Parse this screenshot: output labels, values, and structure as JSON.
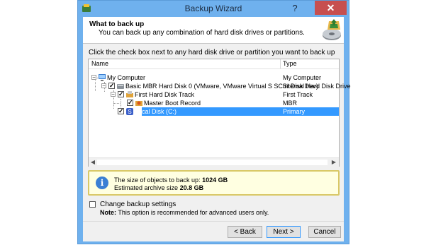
{
  "window": {
    "title": "Backup Wizard",
    "help_glyph": "?",
    "close_glyph": "✕"
  },
  "header": {
    "title": "What to back up",
    "subtitle": "You can back up any combination of hard disk drives or partitions."
  },
  "instruction": "Click the check box next to any hard disk drive or partition you want to back up",
  "tree": {
    "columns": {
      "name": "Name",
      "type": "Type"
    },
    "rows": [
      {
        "name": "My Computer",
        "type": "My Computer",
        "icon": "computer-icon",
        "checked": false
      },
      {
        "name": "Basic MBR Hard Disk 0 (VMware, VMware Virtual S SCSI Disk Dev)",
        "type": "Internal Hard Disk Drive",
        "icon": "hard-disk-icon",
        "checked": true
      },
      {
        "name": "First Hard Disk Track",
        "type": "First Track",
        "icon": "disk-track-icon",
        "checked": true
      },
      {
        "name": "Master Boot Record",
        "type": "MBR",
        "icon": "boot-record-icon",
        "checked": true
      },
      {
        "name": "Local Disk (C:)",
        "type": "Primary",
        "icon": "partition-icon",
        "checked": true,
        "selected": true
      }
    ]
  },
  "info": {
    "size_label": "The size of objects to back up:",
    "size_value": "1024 GB",
    "archive_label": "Estimated archive size",
    "archive_value": "20.8 GB"
  },
  "options": {
    "change_settings_label": "Change backup settings",
    "change_settings_checked": false,
    "note_label": "Note:",
    "note_text": "This option is recommended for advanced users only."
  },
  "buttons": {
    "back": "< Back",
    "next": "Next >",
    "cancel": "Cancel"
  },
  "colors": {
    "titlebar": "#6fb1ee",
    "selection": "#3399ff",
    "close": "#c74f4f",
    "info_bg": "#ffffe1"
  }
}
